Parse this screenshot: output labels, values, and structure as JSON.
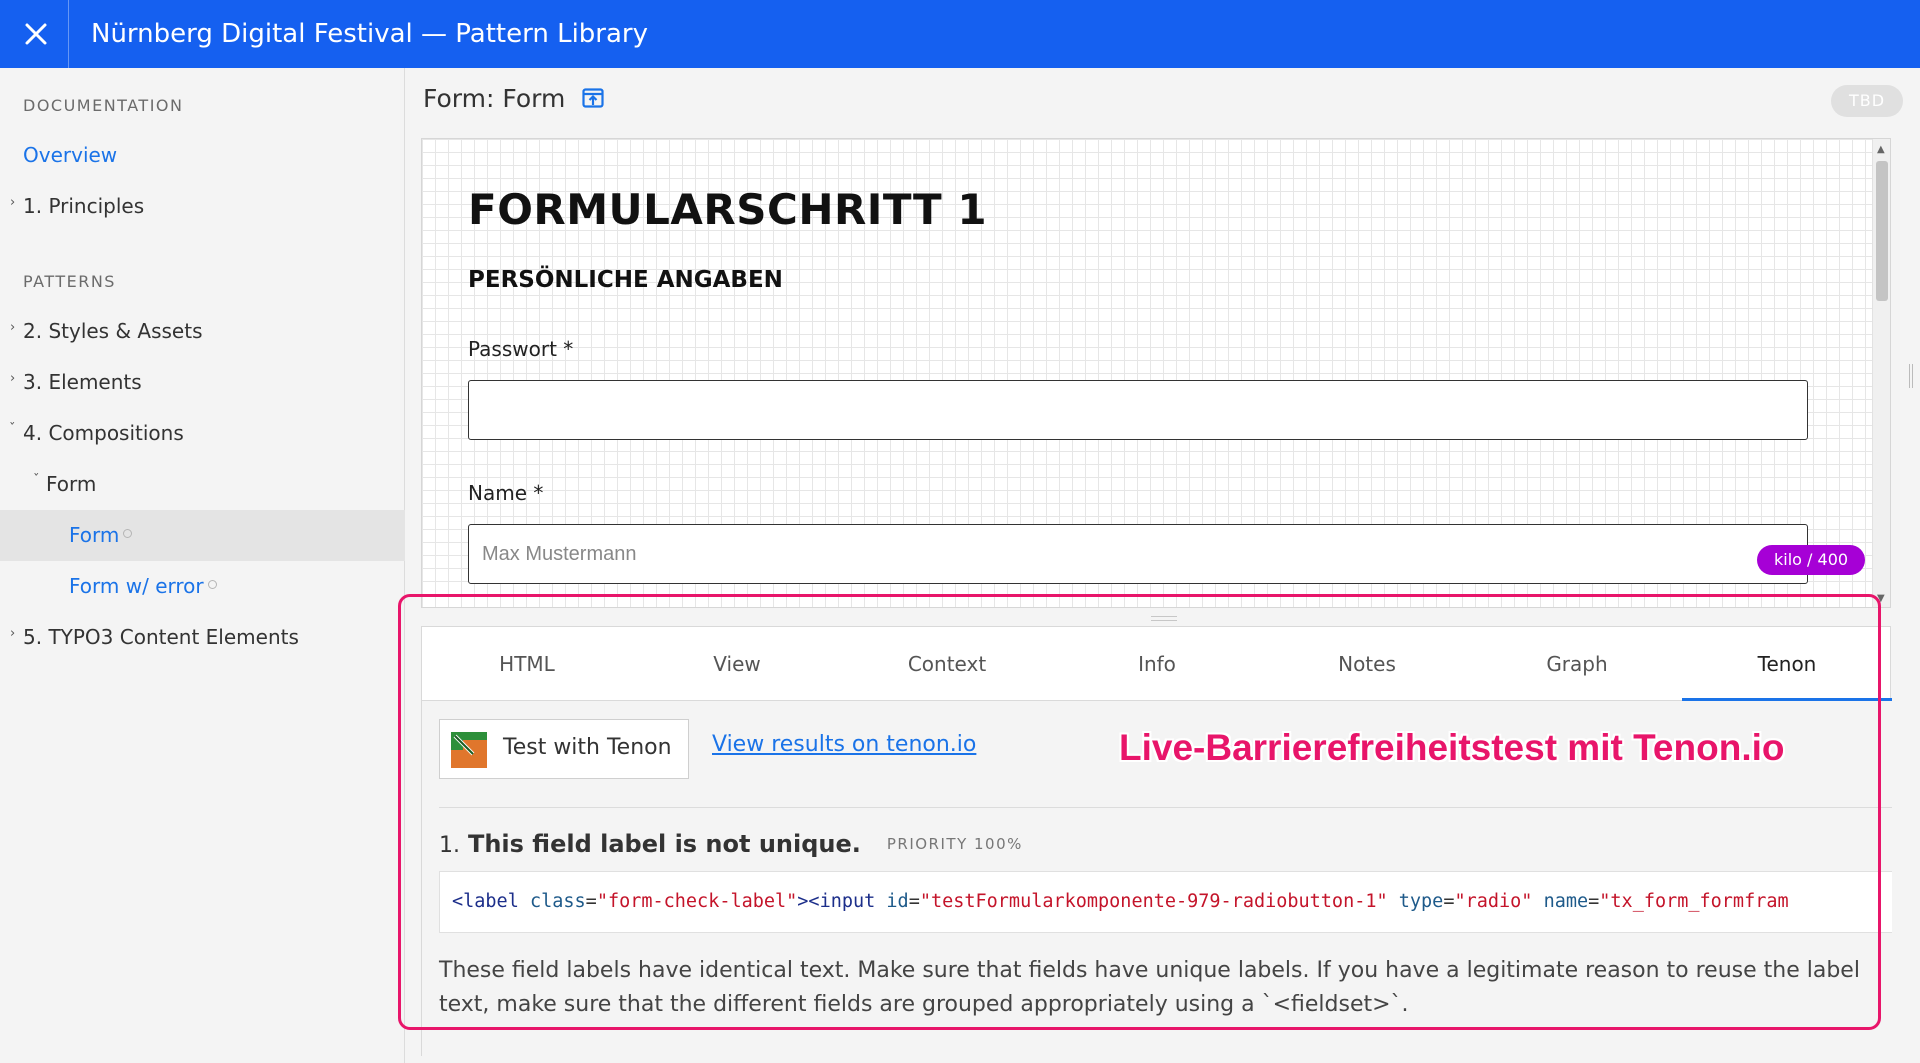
{
  "app": {
    "title": "Nürnberg Digital Festival — Pattern Library"
  },
  "sidebar": {
    "documentation_heading": "DOCUMENTATION",
    "patterns_heading": "PATTERNS",
    "items": [
      {
        "label": "Overview"
      },
      {
        "label": "1. Principles"
      },
      {
        "label": "2. Styles & Assets"
      },
      {
        "label": "3. Elements"
      },
      {
        "label": "4. Compositions"
      },
      {
        "label": "Form"
      },
      {
        "label": "Form"
      },
      {
        "label": "Form w/ error"
      },
      {
        "label": "5. TYPO3 Content Elements"
      }
    ]
  },
  "main": {
    "title": "Form: Form",
    "status_badge": "TBD"
  },
  "preview": {
    "heading": "FORMULARSCHRITT 1",
    "subheading": "PERSÖNLICHE ANGABEN",
    "fields": [
      {
        "label": "Passwort *",
        "value": "",
        "placeholder": ""
      },
      {
        "label": "Name *",
        "value": "",
        "placeholder": "Max Mustermann"
      }
    ],
    "size_badge": "kilo / 400"
  },
  "tabs": [
    {
      "label": "HTML"
    },
    {
      "label": "View"
    },
    {
      "label": "Context"
    },
    {
      "label": "Info"
    },
    {
      "label": "Notes"
    },
    {
      "label": "Graph"
    },
    {
      "label": "Tenon"
    }
  ],
  "active_tab": "Tenon",
  "tenon": {
    "button_label": "Test with Tenon",
    "results_link": "View results on tenon.io",
    "annotation": "Live-Barrierefreiheitstest mit Tenon.io",
    "issue": {
      "number": "1.",
      "title": "This field label is not unique.",
      "priority": "PRIORITY 100%",
      "code": {
        "tag_open": "<label",
        "attr1": "class",
        "val1": "\"form-check-label\"",
        "tag2": "><input",
        "attr2": "id",
        "val2": "\"testFormularkomponente-979-radiobutton-1\"",
        "attr3": "type",
        "val3": "\"radio\"",
        "attr4": "name",
        "val4": "\"tx_form_formfram"
      },
      "description": "These field labels have identical text. Make sure that fields have unique labels. If you have a legitimate reason to reuse the label text, make sure that the different fields are grouped appropriately using a `<fieldset>`."
    }
  },
  "colors": {
    "brand_blue": "#1560f0",
    "link_blue": "#1a73e8",
    "annotation_pink": "#e8156a",
    "size_badge_purple": "#a600d6"
  }
}
